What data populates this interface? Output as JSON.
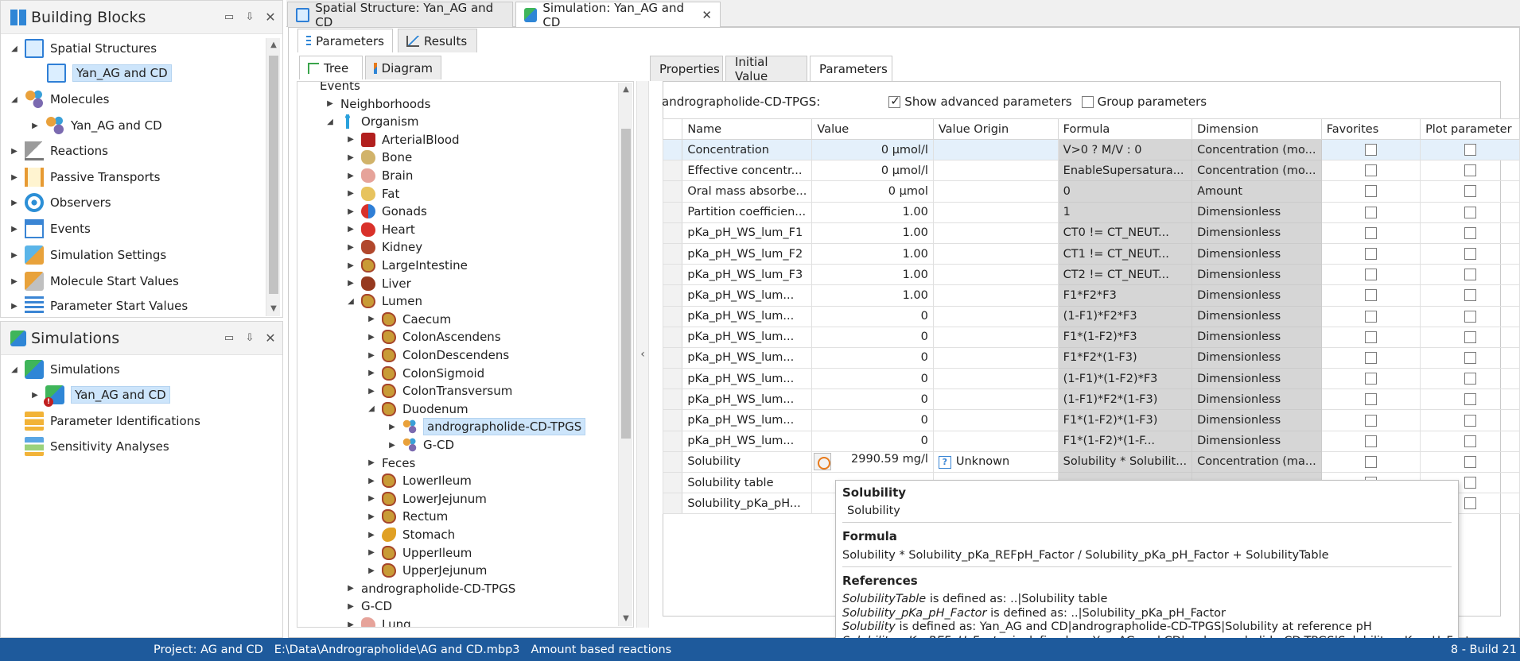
{
  "building_blocks": {
    "title": "Building Blocks",
    "items": [
      {
        "label": "Spatial Structures",
        "icon": "spatial-structure-icon"
      },
      {
        "label": "Yan_AG and CD",
        "icon": "spatial-structure-icon"
      },
      {
        "label": "Molecules",
        "icon": "molecules-icon"
      },
      {
        "label": "Yan_AG and CD",
        "icon": "molecule-icon"
      },
      {
        "label": "Reactions",
        "icon": "reactions-icon"
      },
      {
        "label": "Passive Transports",
        "icon": "passive-transports-icon"
      },
      {
        "label": "Observers",
        "icon": "observers-icon"
      },
      {
        "label": "Events",
        "icon": "events-icon"
      },
      {
        "label": "Simulation Settings",
        "icon": "simulation-settings-icon"
      },
      {
        "label": "Molecule Start Values",
        "icon": "molecule-start-values-icon"
      },
      {
        "label": "Parameter Start Values",
        "icon": "parameter-start-values-icon"
      }
    ]
  },
  "simulations_panel": {
    "title": "Simulations",
    "items": [
      {
        "label": "Simulations",
        "icon": "simulations-icon"
      },
      {
        "label": "Yan_AG and CD",
        "icon": "simulation-icon"
      },
      {
        "label": "Parameter Identifications",
        "icon": "parameter-identification-icon"
      },
      {
        "label": "Sensitivity Analyses",
        "icon": "sensitivity-analysis-icon"
      }
    ]
  },
  "doc_tabs": [
    {
      "label": "Spatial Structure: Yan_AG and CD",
      "icon": "spatial-structure-icon"
    },
    {
      "label": "Simulation: Yan_AG and CD",
      "icon": "simulation-icon"
    }
  ],
  "sim_tabs": {
    "parameters": "Parameters",
    "results": "Results"
  },
  "view_tabs": {
    "tree": "Tree",
    "diagram": "Diagram"
  },
  "organism_tree": [
    {
      "label": "Events",
      "icon": ""
    },
    {
      "label": "Neighborhoods",
      "icon": ""
    },
    {
      "label": "Organism",
      "icon": "organism-icon"
    },
    {
      "label": "ArterialBlood",
      "icon": "arterial-blood-icon"
    },
    {
      "label": "Bone",
      "icon": "bone-icon"
    },
    {
      "label": "Brain",
      "icon": "brain-icon"
    },
    {
      "label": "Fat",
      "icon": "fat-icon"
    },
    {
      "label": "Gonads",
      "icon": "gonads-icon"
    },
    {
      "label": "Heart",
      "icon": "heart-icon"
    },
    {
      "label": "Kidney",
      "icon": "kidney-icon"
    },
    {
      "label": "LargeIntestine",
      "icon": "large-intestine-icon"
    },
    {
      "label": "Liver",
      "icon": "liver-icon"
    },
    {
      "label": "Lumen",
      "icon": "lumen-icon"
    },
    {
      "label": "Caecum",
      "icon": "gut-segment-icon"
    },
    {
      "label": "ColonAscendens",
      "icon": "gut-segment-icon"
    },
    {
      "label": "ColonDescendens",
      "icon": "gut-segment-icon"
    },
    {
      "label": "ColonSigmoid",
      "icon": "gut-segment-icon"
    },
    {
      "label": "ColonTransversum",
      "icon": "gut-segment-icon"
    },
    {
      "label": "Duodenum",
      "icon": "gut-segment-icon"
    },
    {
      "label": "andrographolide-CD-TPGS",
      "icon": "molecule-icon"
    },
    {
      "label": "G-CD",
      "icon": "molecule-icon"
    },
    {
      "label": "Feces",
      "icon": ""
    },
    {
      "label": "LowerIleum",
      "icon": "gut-segment-icon"
    },
    {
      "label": "LowerJejunum",
      "icon": "gut-segment-icon"
    },
    {
      "label": "Rectum",
      "icon": "gut-segment-icon"
    },
    {
      "label": "Stomach",
      "icon": "stomach-icon"
    },
    {
      "label": "UpperIleum",
      "icon": "gut-segment-icon"
    },
    {
      "label": "UpperJejunum",
      "icon": "gut-segment-icon"
    },
    {
      "label": "andrographolide-CD-TPGS",
      "icon": ""
    },
    {
      "label": "G-CD",
      "icon": ""
    },
    {
      "label": "Lung",
      "icon": "lung-icon"
    }
  ],
  "prop_tabs": {
    "properties": "Properties",
    "initial_value": "Initial Value",
    "parameters": "Parameters"
  },
  "params": {
    "container_label": "andrographolide-CD-TPGS:",
    "show_advanced_label": "Show advanced parameters",
    "show_advanced_checked": true,
    "group_label": "Group parameters",
    "group_checked": false,
    "columns": [
      "Name",
      "Value",
      "Value Origin",
      "Formula",
      "Dimension",
      "Favorites",
      "Plot parameter"
    ],
    "rows": [
      {
        "name": "Concentration",
        "value": "0 µmol/l",
        "origin": "",
        "formula": "V>0 ? M/V : 0",
        "dimension": "Concentration (mo..."
      },
      {
        "name": "Effective concentr...",
        "value": "0 µmol/l",
        "origin": "",
        "formula": "EnableSupersatura...",
        "dimension": "Concentration (mo..."
      },
      {
        "name": "Oral mass absorbe...",
        "value": "0 µmol",
        "origin": "",
        "formula": "0",
        "dimension": "Amount"
      },
      {
        "name": "Partition coefficien...",
        "value": "1.00",
        "origin": "",
        "formula": "1",
        "dimension": "Dimensionless"
      },
      {
        "name": "pKa_pH_WS_lum_F1",
        "value": "1.00",
        "origin": "",
        "formula": "CT0 != CT_NEUT...",
        "dimension": "Dimensionless"
      },
      {
        "name": "pKa_pH_WS_lum_F2",
        "value": "1.00",
        "origin": "",
        "formula": "CT1 != CT_NEUT...",
        "dimension": "Dimensionless"
      },
      {
        "name": "pKa_pH_WS_lum_F3",
        "value": "1.00",
        "origin": "",
        "formula": "CT2 != CT_NEUT...",
        "dimension": "Dimensionless"
      },
      {
        "name": "pKa_pH_WS_lum...",
        "value": "1.00",
        "origin": "",
        "formula": "F1*F2*F3",
        "dimension": "Dimensionless"
      },
      {
        "name": "pKa_pH_WS_lum...",
        "value": "0",
        "origin": "",
        "formula": "(1-F1)*F2*F3",
        "dimension": "Dimensionless"
      },
      {
        "name": "pKa_pH_WS_lum...",
        "value": "0",
        "origin": "",
        "formula": "F1*(1-F2)*F3",
        "dimension": "Dimensionless"
      },
      {
        "name": "pKa_pH_WS_lum...",
        "value": "0",
        "origin": "",
        "formula": "F1*F2*(1-F3)",
        "dimension": "Dimensionless"
      },
      {
        "name": "pKa_pH_WS_lum...",
        "value": "0",
        "origin": "",
        "formula": "(1-F1)*(1-F2)*F3",
        "dimension": "Dimensionless"
      },
      {
        "name": "pKa_pH_WS_lum...",
        "value": "0",
        "origin": "",
        "formula": "(1-F1)*F2*(1-F3)",
        "dimension": "Dimensionless"
      },
      {
        "name": "pKa_pH_WS_lum...",
        "value": "0",
        "origin": "",
        "formula": "F1*(1-F2)*(1-F3)",
        "dimension": "Dimensionless"
      },
      {
        "name": "pKa_pH_WS_lum...",
        "value": "0",
        "origin": "",
        "formula": "F1*(1-F2)*(1-F...",
        "dimension": "Dimensionless"
      },
      {
        "name": "Solubility",
        "value": "2990.59 mg/l",
        "origin": "Unknown",
        "formula": "Solubility * Solubilit...",
        "dimension": "Concentration (ma..."
      },
      {
        "name": "Solubility table",
        "value": "",
        "origin": "",
        "formula": "",
        "dimension": ""
      },
      {
        "name": "Solubility_pKa_pH...",
        "value": "",
        "origin": "",
        "formula": "",
        "dimension": ""
      }
    ]
  },
  "tooltip": {
    "title": "Solubility",
    "name": "Solubility",
    "formula_header": "Formula",
    "formula": "Solubility * Solubility_pKa_REFpH_Factor / Solubility_pKa_pH_Factor + SolubilityTable",
    "references_header": "References",
    "references": [
      {
        "alias": "SolubilityTable",
        "text": " is defined as: ..|Solubility table"
      },
      {
        "alias": "Solubility_pKa_pH_Factor",
        "text": " is defined as: ..|Solubility_pKa_pH_Factor"
      },
      {
        "alias": "Solubility",
        "text": " is defined as: Yan_AG and CD|andrographolide-CD-TPGS|Solubility at reference pH"
      },
      {
        "alias": "Solubility_pKa_REFpH_Factor",
        "text": " is defined as: Yan_AG and CD|andrographolide-CD-TPGS|Solubility_pKa_pH_Factor"
      }
    ]
  },
  "status": {
    "project": "Project: AG and CD",
    "path": "E:\\Data\\Andrographolide\\AG and CD.mbp3",
    "mode": "Amount based reactions",
    "build": "8 - Build 21"
  }
}
